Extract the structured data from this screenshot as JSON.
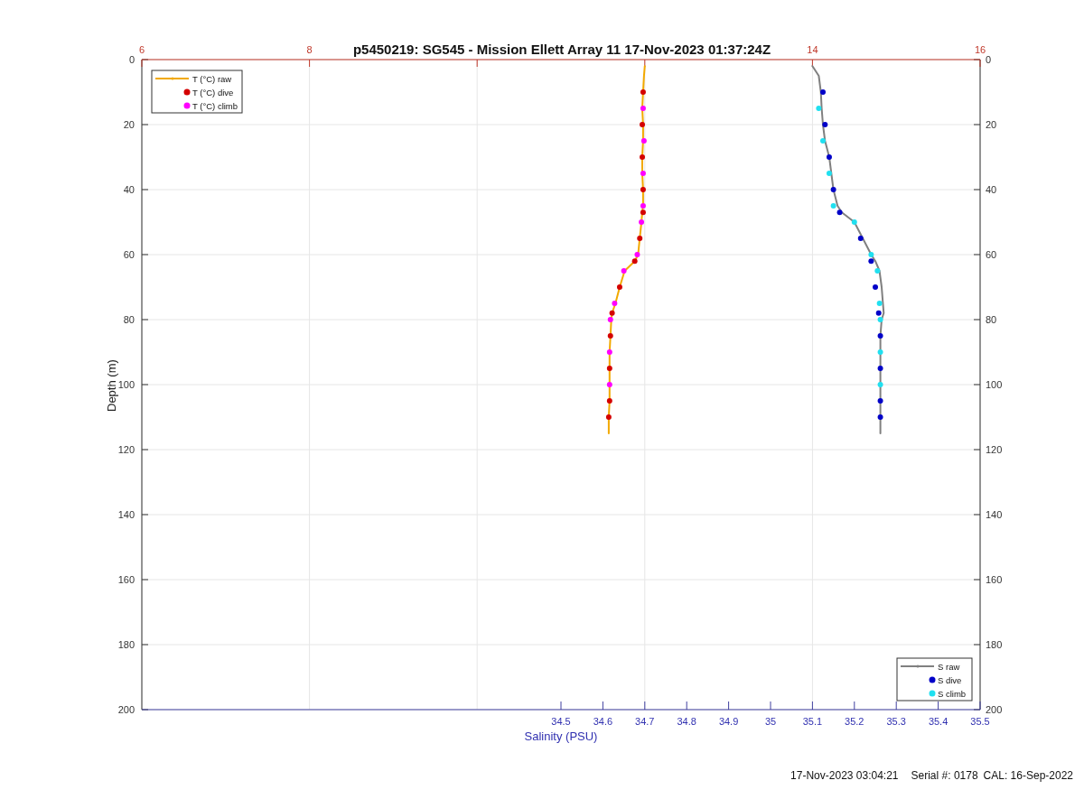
{
  "figure": {
    "title": "p5450219: SG545 - Mission Ellett Array 11 17-Nov-2023 01:37:24Z",
    "plot": {
      "chart_data": {
        "type": "line",
        "orientation": "horizontal",
        "xlabel": "Salinity (PSU)",
        "ylabel": "Depth (m)",
        "xlim": [
          33.5,
          35.5
        ],
        "ylim": [
          200,
          0
        ],
        "x2lim": [
          6,
          16
        ],
        "y2lim": [
          200,
          0
        ],
        "grid": true,
        "legend": [
          "upper left",
          "lower right"
        ],
        "xticks": [
          {
            "value": 34.5,
            "label": "34.5"
          },
          {
            "value": 34.6,
            "label": "34.6"
          },
          {
            "value": 34.7,
            "label": "34.7"
          },
          {
            "value": 34.8,
            "label": "34.8"
          },
          {
            "value": 34.9,
            "label": "34.9"
          },
          {
            "value": 35,
            "label": "35"
          },
          {
            "value": 35.1,
            "label": "35.1"
          },
          {
            "value": 35.2,
            "label": "35.2"
          },
          {
            "value": 35.3,
            "label": "35.3"
          },
          {
            "value": 35.4,
            "label": "35.4"
          },
          {
            "value": 35.5,
            "label": "35.5"
          }
        ],
        "x2ticks": [
          6,
          8,
          14,
          16
        ],
        "yticks": [
          0,
          20,
          40,
          60,
          80,
          100,
          120,
          140,
          160,
          180,
          200
        ],
        "y2ticks": [
          0,
          20,
          40,
          60,
          80,
          100,
          120,
          140,
          160,
          180,
          200
        ],
        "x": [
          2,
          5,
          10,
          15,
          20,
          25,
          30,
          35,
          40,
          45,
          47,
          50,
          55,
          60,
          62,
          65,
          70,
          75,
          78,
          80,
          85,
          90,
          95,
          100,
          105,
          110,
          115
        ],
        "series": [
          {
            "name": "T (°C) raw",
            "color": "#f2a900",
            "axis": "x2",
            "type": "line",
            "values": [
              12.0,
              11.99,
              11.98,
              11.97,
              11.98,
              11.98,
              11.97,
              11.97,
              11.98,
              11.98,
              11.97,
              11.96,
              11.94,
              11.92,
              11.88,
              11.76,
              11.7,
              11.65,
              11.61,
              11.6,
              11.59,
              11.58,
              11.58,
              11.58,
              11.58,
              11.57,
              11.57
            ]
          },
          {
            "name": "T (°C) dive",
            "color": "#d40000",
            "axis": "x2",
            "type": "scatter",
            "values": [
              null,
              null,
              11.98,
              null,
              11.97,
              null,
              11.97,
              null,
              11.98,
              null,
              11.98,
              null,
              11.94,
              null,
              11.88,
              null,
              11.7,
              null,
              11.61,
              null,
              11.59,
              null,
              11.58,
              null,
              11.58,
              11.57,
              null
            ]
          },
          {
            "name": "T (°C) climb",
            "color": "#ff00ff",
            "axis": "x2",
            "type": "scatter",
            "values": [
              null,
              null,
              null,
              11.98,
              null,
              11.99,
              null,
              11.98,
              null,
              11.98,
              null,
              11.96,
              null,
              11.91,
              null,
              11.75,
              null,
              11.64,
              null,
              11.59,
              null,
              11.58,
              null,
              11.58,
              null,
              null,
              null
            ]
          },
          {
            "name": "S raw",
            "color": "#808080",
            "type": "line",
            "values": [
              35.1,
              35.115,
              35.12,
              35.122,
              35.125,
              35.13,
              35.14,
              35.145,
              35.15,
              35.16,
              35.17,
              35.2,
              35.22,
              35.24,
              35.25,
              35.26,
              35.265,
              35.268,
              35.27,
              35.265,
              35.262,
              35.262,
              35.262,
              35.262,
              35.262,
              35.262,
              35.262
            ]
          },
          {
            "name": "S dive",
            "color": "#0000c8",
            "type": "scatter",
            "values": [
              null,
              null,
              35.125,
              null,
              35.13,
              null,
              35.14,
              null,
              35.15,
              null,
              35.165,
              null,
              35.215,
              null,
              35.24,
              null,
              35.25,
              null,
              35.258,
              null,
              35.262,
              null,
              35.262,
              null,
              35.262,
              35.262,
              null
            ]
          },
          {
            "name": "S climb",
            "color": "#20e0f0",
            "type": "scatter",
            "values": [
              null,
              null,
              null,
              35.115,
              null,
              35.125,
              null,
              35.14,
              null,
              35.15,
              null,
              35.2,
              null,
              35.24,
              null,
              35.255,
              null,
              35.26,
              null,
              35.262,
              null,
              35.262,
              null,
              35.262,
              null,
              null,
              null
            ]
          }
        ]
      }
    },
    "footer": {
      "timestamp": "17-Nov-2023 03:04:21",
      "serial": "Serial #: 0178",
      "calibration": "CAL: 16-Sep-2022"
    }
  }
}
